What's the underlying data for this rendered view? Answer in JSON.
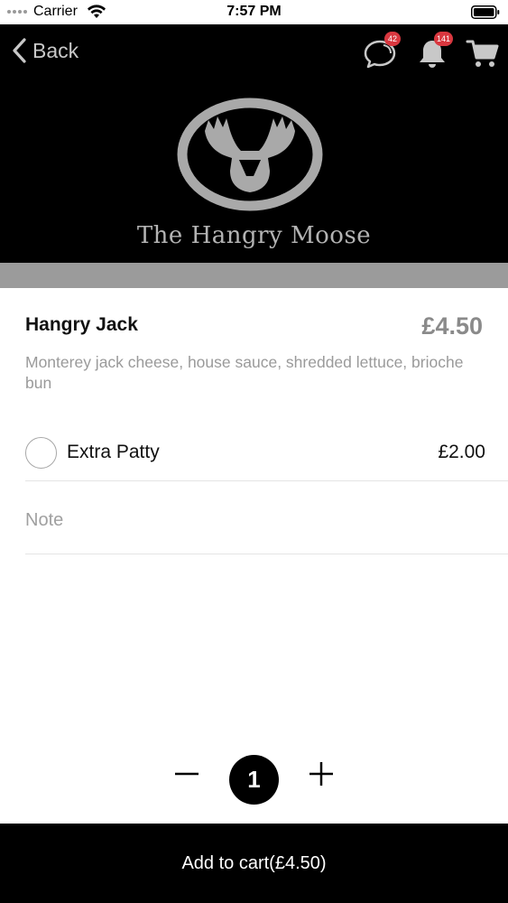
{
  "status_bar": {
    "carrier": "Carrier",
    "time": "7:57 PM"
  },
  "header": {
    "back_label": "Back",
    "chat_badge": "42",
    "notification_badge": "141",
    "restaurant_name": "The Hangry Moose",
    "icons": [
      "chevron-left-icon",
      "chat-icon",
      "bell-icon",
      "cart-icon",
      "moose-logo"
    ]
  },
  "item": {
    "name": "Hangry Jack",
    "price": "£4.50",
    "description": "Monterey jack cheese, house sauce, shredded lettuce, brioche bun"
  },
  "options": [
    {
      "label": "Extra Patty",
      "price": "£2.00",
      "selected": false
    }
  ],
  "note": {
    "placeholder": "Note",
    "value": ""
  },
  "quantity": {
    "value": "1"
  },
  "cart_button": {
    "label": "Add to cart(£4.50)"
  },
  "colors": {
    "header_bg": "#000000",
    "band": "#9b9b9b",
    "badge": "#d9373f",
    "price_grey": "#8a8a8a",
    "button_bg": "#000000"
  }
}
